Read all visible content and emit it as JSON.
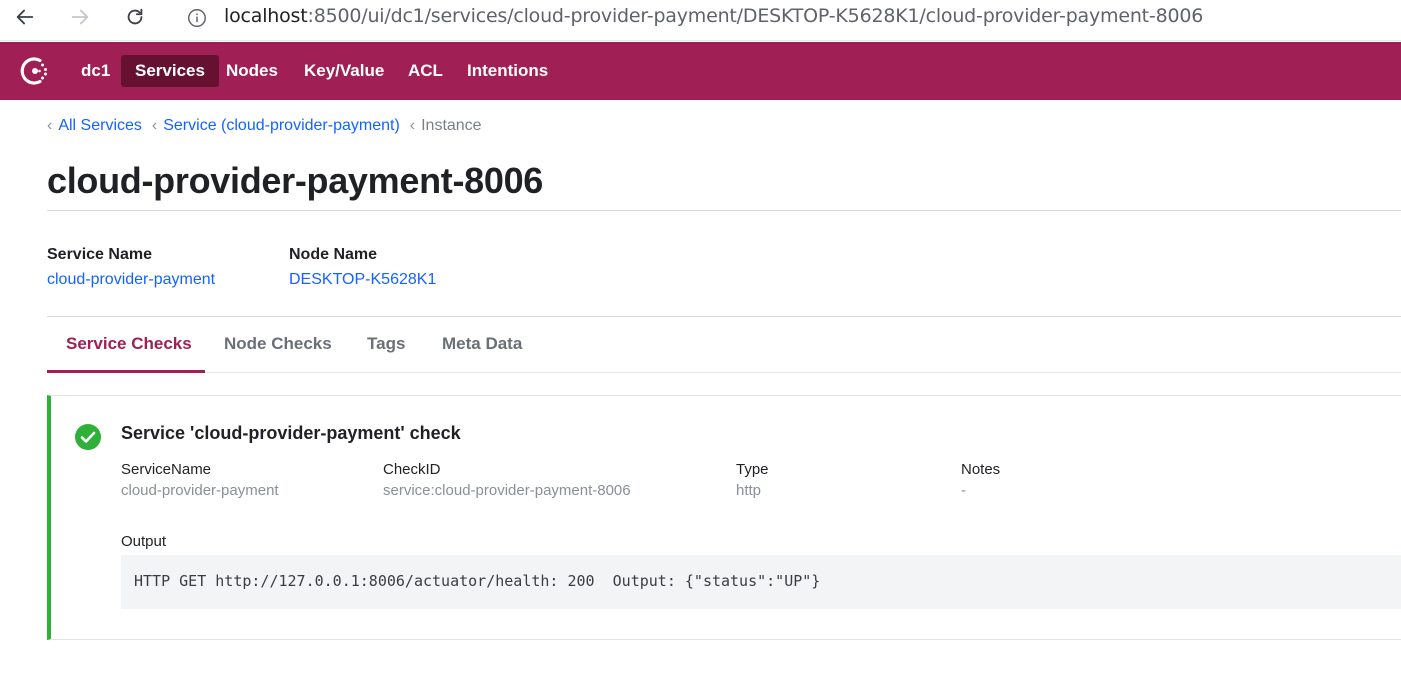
{
  "browser": {
    "url_host": "localhost",
    "url_rest": ":8500/ui/dc1/services/cloud-provider-payment/DESKTOP-K5628K1/cloud-provider-payment-8006"
  },
  "header": {
    "datacenter": "dc1",
    "nav": [
      "Services",
      "Nodes",
      "Key/Value",
      "ACL",
      "Intentions"
    ],
    "active_nav": "Services",
    "brand_color": "#a01f55"
  },
  "breadcrumb": {
    "all_services": "All Services",
    "service": "Service (cloud-provider-payment)",
    "current": "Instance"
  },
  "page": {
    "title": "cloud-provider-payment-8006"
  },
  "meta": {
    "service_name_label": "Service Name",
    "service_name_value": "cloud-provider-payment",
    "node_name_label": "Node Name",
    "node_name_value": "DESKTOP-K5628K1"
  },
  "tabs": [
    "Service Checks",
    "Node Checks",
    "Tags",
    "Meta Data"
  ],
  "check": {
    "status": "passing",
    "status_color": "#2eb039",
    "title": "Service 'cloud-provider-payment' check",
    "columns": [
      {
        "label": "ServiceName",
        "value": "cloud-provider-payment"
      },
      {
        "label": "CheckID",
        "value": "service:cloud-provider-payment-8006"
      },
      {
        "label": "Type",
        "value": "http"
      },
      {
        "label": "Notes",
        "value": "-"
      }
    ],
    "output_label": "Output",
    "output": "HTTP GET http://127.0.0.1:8006/actuator/health: 200  Output: {\"status\":\"UP\"}"
  }
}
